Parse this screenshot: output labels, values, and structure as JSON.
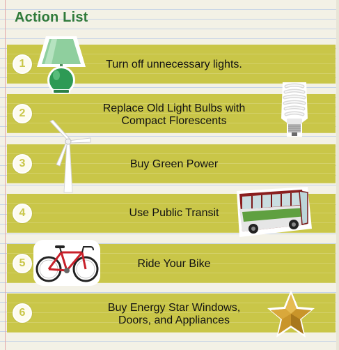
{
  "title": "Action List",
  "items": [
    {
      "num": "1",
      "label": "Turn off unnecessary lights.",
      "icon": "lamp-icon"
    },
    {
      "num": "2",
      "label_line1": "Replace Old Light Bulbs with",
      "label_line2": "Compact Florescents",
      "icon": "cfl-bulb-icon"
    },
    {
      "num": "3",
      "label": "Buy Green Power",
      "icon": "wind-turbine-icon"
    },
    {
      "num": "4",
      "label": "Use Public Transit",
      "icon": "bus-icon"
    },
    {
      "num": "5",
      "label": "Ride Your Bike",
      "icon": "bicycle-icon"
    },
    {
      "num": "6",
      "label_line1": "Buy Energy Star Windows,",
      "label_line2": "Doors, and Appliances",
      "icon": "star-icon"
    }
  ],
  "colors": {
    "band": "#c9c648",
    "title": "#2f7a3a",
    "paper": "#f3f1e6",
    "rule_line": "#c5d3e6",
    "margin_line": "#e4a8a8"
  }
}
